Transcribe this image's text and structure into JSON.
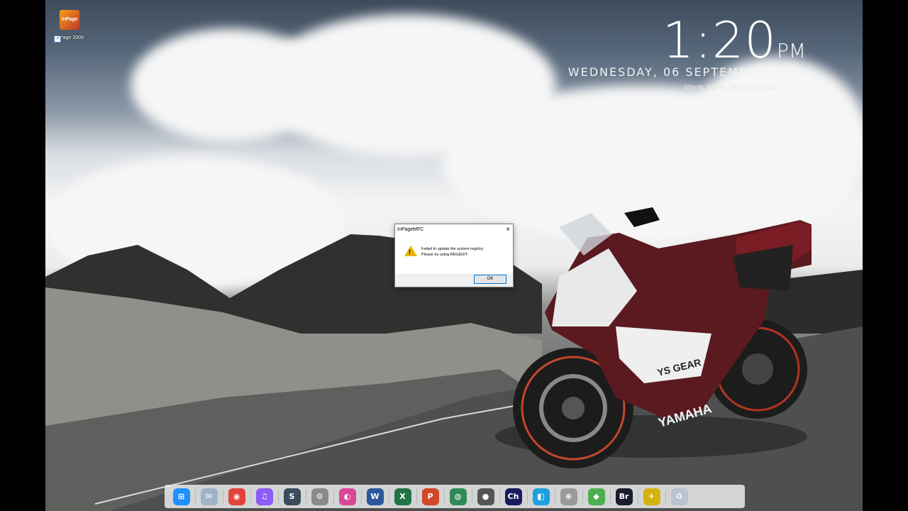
{
  "desktop": {
    "icons": [
      {
        "label": "InPage 2009",
        "badge": "InPage"
      }
    ]
  },
  "clock": {
    "time": "1:20",
    "ampm": "PM",
    "date": "WEDNESDAY, 06 SEPTEMBER 2023",
    "motto": "Work hard. Stay humble."
  },
  "wallpaper": {
    "bike_brand": "YAMAHA",
    "fairing_text": "YS GEAR"
  },
  "dialog": {
    "title": "InPageMFC",
    "close_glyph": "×",
    "message_line1": "Failed to update the system registry.",
    "message_line2": "Please try using REGEDIT.",
    "ok_label": "OK"
  },
  "dock": {
    "items": [
      {
        "name": "windows-start-icon",
        "glyph": "⊞",
        "color": "#1e90ff"
      },
      {
        "name": "mail-icon",
        "glyph": "✉",
        "color": "#9fb3c8"
      },
      {
        "name": "chrome-icon",
        "glyph": "◉",
        "color": "#e0443a"
      },
      {
        "name": "music-icon",
        "glyph": "♫",
        "color": "#8b5cf6"
      },
      {
        "name": "s-app-icon",
        "glyph": "S",
        "color": "#3a4b5c"
      },
      {
        "name": "settings-icon",
        "glyph": "⚙",
        "color": "#8a8a8a"
      },
      {
        "name": "paint-app-icon",
        "glyph": "◐",
        "color": "#d9479a"
      },
      {
        "name": "word-icon",
        "glyph": "W",
        "color": "#2b579a"
      },
      {
        "name": "excel-icon",
        "glyph": "X",
        "color": "#217346"
      },
      {
        "name": "powerpoint-icon",
        "glyph": "P",
        "color": "#d24726"
      },
      {
        "name": "globe-download-icon",
        "glyph": "◍",
        "color": "#2e8b57"
      },
      {
        "name": "toggle-app-icon",
        "glyph": "●",
        "color": "#555555"
      },
      {
        "name": "character-animator-icon",
        "glyph": "Ch",
        "color": "#1a1a5e"
      },
      {
        "name": "store-icon",
        "glyph": "◧",
        "color": "#1ca0e0"
      },
      {
        "name": "crosshair-icon",
        "glyph": "⊕",
        "color": "#9a9a9a"
      },
      {
        "name": "gamepad-icon",
        "glyph": "◆",
        "color": "#4caf50"
      },
      {
        "name": "bridge-icon",
        "glyph": "Br",
        "color": "#1b1b2f"
      },
      {
        "name": "plane-app-icon",
        "glyph": "✈",
        "color": "#d4b20f"
      },
      {
        "name": "recycle-bin-icon",
        "glyph": "♻",
        "color": "#b8c4d0"
      }
    ]
  }
}
